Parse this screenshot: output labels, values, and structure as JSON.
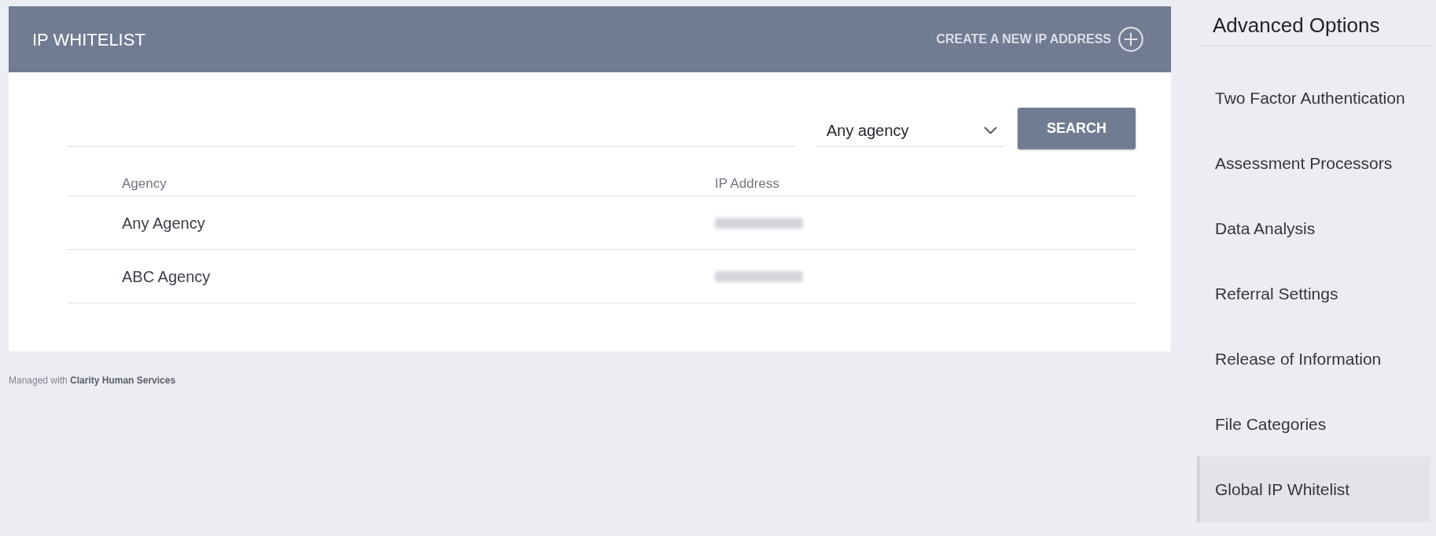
{
  "panel": {
    "title": "IP WHITELIST",
    "create_link": "CREATE A NEW IP ADDRESS"
  },
  "search": {
    "select": {
      "value": "Any agency"
    },
    "button": "SEARCH"
  },
  "table": {
    "columns": [
      "Agency",
      "IP Address"
    ],
    "rows": [
      {
        "agency": "Any Agency",
        "ip_redacted": true
      },
      {
        "agency": "ABC Agency",
        "ip_redacted": true
      }
    ]
  },
  "footer": "Managed with **Clarity Human Services**",
  "sidebar": {
    "title": "Advanced Options",
    "items": [
      {
        "label": "Two Factor Authentication",
        "selected": false
      },
      {
        "label": "Assessment Processors",
        "selected": false
      },
      {
        "label": "Data Analysis",
        "selected": false
      },
      {
        "label": "Referral Settings",
        "selected": false
      },
      {
        "label": "Release of Information",
        "selected": false
      },
      {
        "label": "File Categories",
        "selected": false
      },
      {
        "label": "Global IP Whitelist",
        "selected": true
      }
    ]
  }
}
